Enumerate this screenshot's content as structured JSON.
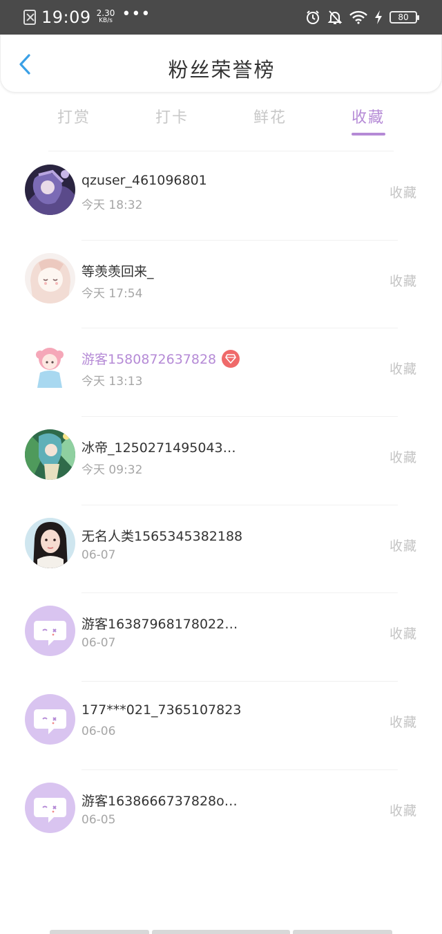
{
  "status_bar": {
    "time": "19:09",
    "speed_value": "2.30",
    "speed_unit": "KB/s",
    "dots": "•••",
    "battery": "80",
    "icons": [
      "sim-off-icon",
      "alarm-icon",
      "mute-bell-icon",
      "wifi-icon",
      "charging-icon",
      "battery-icon"
    ]
  },
  "header": {
    "title": "粉丝荣誉榜",
    "back_icon": "chevron-left-icon"
  },
  "colors": {
    "accent": "#b58ad6",
    "badge": "#ef6a6a",
    "back_arrow": "#3aa0e6",
    "inactive_tab": "#c8c8c8",
    "secondary_text": "#a6a6a6"
  },
  "tabs": [
    {
      "label": "打赏",
      "active": false
    },
    {
      "label": "打卡",
      "active": false
    },
    {
      "label": "鲜花",
      "active": false
    },
    {
      "label": "收藏",
      "active": true
    }
  ],
  "fans": [
    {
      "name": "qzuser_461096801",
      "time": "今天 18:32",
      "action": "收藏",
      "avatar": "anime-avatar-purple",
      "vip": false
    },
    {
      "name": "等羡羡回来_",
      "time": "今天 17:54",
      "action": "收藏",
      "avatar": "anime-avatar-pink-hair",
      "vip": false
    },
    {
      "name": "游客1580872637828",
      "time": "今天 13:13",
      "action": "收藏",
      "avatar": "anime-avatar-chibi",
      "vip": true
    },
    {
      "name": "冰帝_1250271495043…",
      "time": "今天 09:32",
      "action": "收藏",
      "avatar": "anime-avatar-green",
      "vip": false
    },
    {
      "name": "无名人类1565345382188",
      "time": "06-07",
      "action": "收藏",
      "avatar": "photo-avatar-girl",
      "vip": false
    },
    {
      "name": "游客16387968178022…",
      "time": "06-07",
      "action": "收藏",
      "avatar": "default-chat-avatar",
      "vip": false
    },
    {
      "name": "177***021_7365107823",
      "time": "06-06",
      "action": "收藏",
      "avatar": "default-chat-avatar",
      "vip": false
    },
    {
      "name": "游客1638666737828o…",
      "time": "06-05",
      "action": "收藏",
      "avatar": "default-chat-avatar",
      "vip": false
    }
  ]
}
